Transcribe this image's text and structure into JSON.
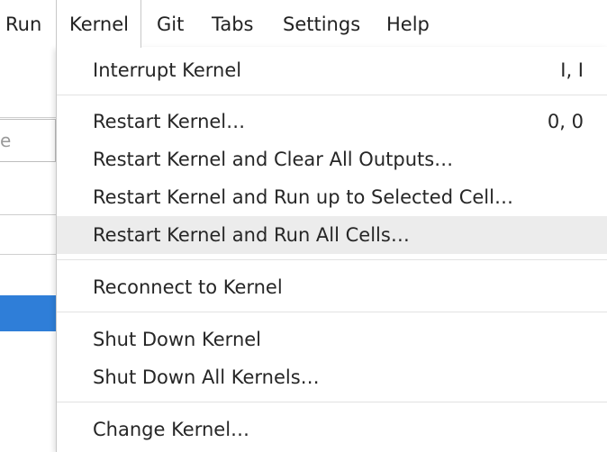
{
  "menubar": {
    "items": [
      {
        "label": "Run"
      },
      {
        "label": "Kernel"
      },
      {
        "label": "Git"
      },
      {
        "label": "Tabs"
      },
      {
        "label": "Settings"
      },
      {
        "label": "Help"
      }
    ],
    "active": "Kernel"
  },
  "left_panel": {
    "filter_placeholder_fragment": "e",
    "upload_icon": "upload-icon"
  },
  "kernel_menu": {
    "items": [
      {
        "label": "Interrupt Kernel",
        "shortcut": "I, I"
      },
      {
        "label": "Restart Kernel…",
        "shortcut": "0, 0"
      },
      {
        "label": "Restart Kernel and Clear All Outputs…",
        "shortcut": ""
      },
      {
        "label": "Restart Kernel and Run up to Selected Cell…",
        "shortcut": ""
      },
      {
        "label": "Restart Kernel and Run All Cells…",
        "shortcut": ""
      },
      {
        "label": "Reconnect to Kernel",
        "shortcut": ""
      },
      {
        "label": "Shut Down Kernel",
        "shortcut": ""
      },
      {
        "label": "Shut Down All Kernels…",
        "shortcut": ""
      },
      {
        "label": "Change Kernel…",
        "shortcut": ""
      }
    ],
    "hovered_item": "Restart Kernel and Run All Cells…"
  },
  "colors": {
    "accent": "#2f7ed8",
    "hover_bg": "#ececec",
    "separator": "#e2e2e2"
  }
}
